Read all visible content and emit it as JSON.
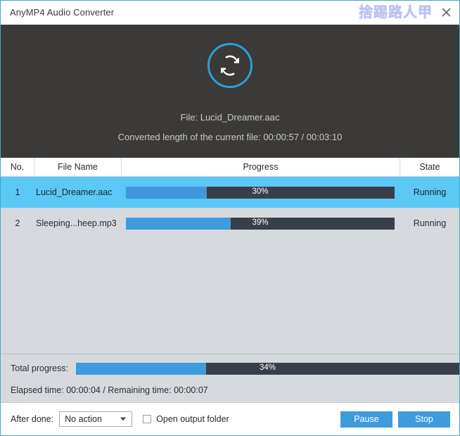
{
  "window": {
    "title": "AnyMP4 Audio Converter",
    "watermark": "捨踢路人甲",
    "close_icon": "close-icon"
  },
  "hero": {
    "icon": "convert-refresh-icon",
    "accent_color": "#2f9fd4",
    "background_color": "#3b3a38",
    "file_line": "File: Lucid_Dreamer.aac",
    "length_line": "Converted length of the current file: 00:00:57 / 00:03:10"
  },
  "table": {
    "columns": [
      "No.",
      "File Name",
      "Progress",
      "State"
    ],
    "rows": [
      {
        "no": "1",
        "name": "Lucid_Dreamer.aac",
        "progress_label": "30%",
        "progress_value": 30,
        "state": "Running",
        "selected": true
      },
      {
        "no": "2",
        "name": "Sleeping...heep.mp3",
        "progress_label": "39%",
        "progress_value": 39,
        "state": "Running",
        "selected": false
      }
    ]
  },
  "total": {
    "label": "Total progress:",
    "progress_label": "34%",
    "progress_value": 34,
    "time_line": "Elapsed time: 00:00:04 / Remaining time: 00:00:07"
  },
  "bottom": {
    "after_done_label": "After done:",
    "after_done_value": "No action",
    "open_folder_label": "Open output folder",
    "open_folder_checked": false,
    "pause_label": "Pause",
    "stop_label": "Stop",
    "button_color": "#3e9bdd"
  },
  "colors": {
    "progress_fill": "#3e9bdd",
    "progress_track": "#393f4a",
    "selected_row": "#5bc8f5",
    "list_background": "#d6dade",
    "window_border": "#3fa9d4"
  }
}
